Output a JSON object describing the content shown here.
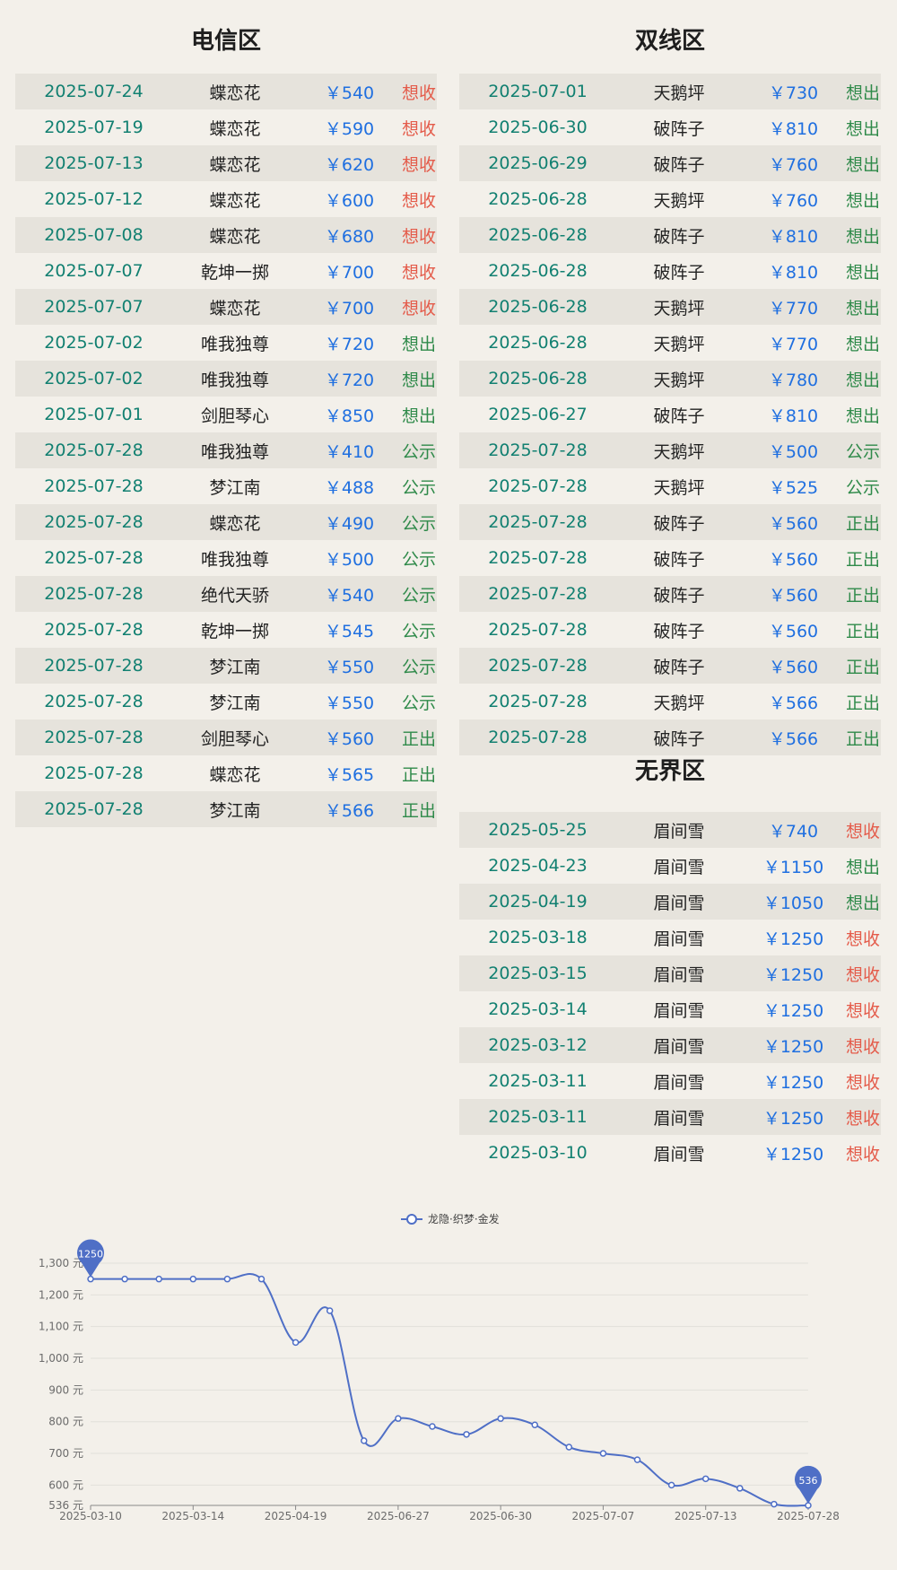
{
  "sections": {
    "telecom": {
      "title": "电信区",
      "rows": [
        {
          "date": "2025-07-24",
          "name": "蝶恋花",
          "price": "￥540",
          "status": "想收"
        },
        {
          "date": "2025-07-19",
          "name": "蝶恋花",
          "price": "￥590",
          "status": "想收"
        },
        {
          "date": "2025-07-13",
          "name": "蝶恋花",
          "price": "￥620",
          "status": "想收"
        },
        {
          "date": "2025-07-12",
          "name": "蝶恋花",
          "price": "￥600",
          "status": "想收"
        },
        {
          "date": "2025-07-08",
          "name": "蝶恋花",
          "price": "￥680",
          "status": "想收"
        },
        {
          "date": "2025-07-07",
          "name": "乾坤一掷",
          "price": "￥700",
          "status": "想收"
        },
        {
          "date": "2025-07-07",
          "name": "蝶恋花",
          "price": "￥700",
          "status": "想收"
        },
        {
          "date": "2025-07-02",
          "name": "唯我独尊",
          "price": "￥720",
          "status": "想出"
        },
        {
          "date": "2025-07-02",
          "name": "唯我独尊",
          "price": "￥720",
          "status": "想出"
        },
        {
          "date": "2025-07-01",
          "name": "剑胆琴心",
          "price": "￥850",
          "status": "想出"
        },
        {
          "date": "2025-07-28",
          "name": "唯我独尊",
          "price": "￥410",
          "status": "公示"
        },
        {
          "date": "2025-07-28",
          "name": "梦江南",
          "price": "￥488",
          "status": "公示"
        },
        {
          "date": "2025-07-28",
          "name": "蝶恋花",
          "price": "￥490",
          "status": "公示"
        },
        {
          "date": "2025-07-28",
          "name": "唯我独尊",
          "price": "￥500",
          "status": "公示"
        },
        {
          "date": "2025-07-28",
          "name": "绝代天骄",
          "price": "￥540",
          "status": "公示"
        },
        {
          "date": "2025-07-28",
          "name": "乾坤一掷",
          "price": "￥545",
          "status": "公示"
        },
        {
          "date": "2025-07-28",
          "name": "梦江南",
          "price": "￥550",
          "status": "公示"
        },
        {
          "date": "2025-07-28",
          "name": "梦江南",
          "price": "￥550",
          "status": "公示"
        },
        {
          "date": "2025-07-28",
          "name": "剑胆琴心",
          "price": "￥560",
          "status": "正出"
        },
        {
          "date": "2025-07-28",
          "name": "蝶恋花",
          "price": "￥565",
          "status": "正出"
        },
        {
          "date": "2025-07-28",
          "name": "梦江南",
          "price": "￥566",
          "status": "正出"
        }
      ]
    },
    "dual": {
      "title": "双线区",
      "rows": [
        {
          "date": "2025-07-01",
          "name": "天鹅坪",
          "price": "￥730",
          "status": "想出"
        },
        {
          "date": "2025-06-30",
          "name": "破阵子",
          "price": "￥810",
          "status": "想出"
        },
        {
          "date": "2025-06-29",
          "name": "破阵子",
          "price": "￥760",
          "status": "想出"
        },
        {
          "date": "2025-06-28",
          "name": "天鹅坪",
          "price": "￥760",
          "status": "想出"
        },
        {
          "date": "2025-06-28",
          "name": "破阵子",
          "price": "￥810",
          "status": "想出"
        },
        {
          "date": "2025-06-28",
          "name": "破阵子",
          "price": "￥810",
          "status": "想出"
        },
        {
          "date": "2025-06-28",
          "name": "天鹅坪",
          "price": "￥770",
          "status": "想出"
        },
        {
          "date": "2025-06-28",
          "name": "天鹅坪",
          "price": "￥770",
          "status": "想出"
        },
        {
          "date": "2025-06-28",
          "name": "天鹅坪",
          "price": "￥780",
          "status": "想出"
        },
        {
          "date": "2025-06-27",
          "name": "破阵子",
          "price": "￥810",
          "status": "想出"
        },
        {
          "date": "2025-07-28",
          "name": "天鹅坪",
          "price": "￥500",
          "status": "公示"
        },
        {
          "date": "2025-07-28",
          "name": "天鹅坪",
          "price": "￥525",
          "status": "公示"
        },
        {
          "date": "2025-07-28",
          "name": "破阵子",
          "price": "￥560",
          "status": "正出"
        },
        {
          "date": "2025-07-28",
          "name": "破阵子",
          "price": "￥560",
          "status": "正出"
        },
        {
          "date": "2025-07-28",
          "name": "破阵子",
          "price": "￥560",
          "status": "正出"
        },
        {
          "date": "2025-07-28",
          "name": "破阵子",
          "price": "￥560",
          "status": "正出"
        },
        {
          "date": "2025-07-28",
          "name": "破阵子",
          "price": "￥560",
          "status": "正出"
        },
        {
          "date": "2025-07-28",
          "name": "天鹅坪",
          "price": "￥566",
          "status": "正出"
        },
        {
          "date": "2025-07-28",
          "name": "破阵子",
          "price": "￥566",
          "status": "正出"
        }
      ]
    },
    "boundless": {
      "title": "无界区",
      "rows": [
        {
          "date": "2025-05-25",
          "name": "眉间雪",
          "price": "￥740",
          "status": "想收"
        },
        {
          "date": "2025-04-23",
          "name": "眉间雪",
          "price": "￥1150",
          "status": "想出"
        },
        {
          "date": "2025-04-19",
          "name": "眉间雪",
          "price": "￥1050",
          "status": "想出"
        },
        {
          "date": "2025-03-18",
          "name": "眉间雪",
          "price": "￥1250",
          "status": "想收"
        },
        {
          "date": "2025-03-15",
          "name": "眉间雪",
          "price": "￥1250",
          "status": "想收"
        },
        {
          "date": "2025-03-14",
          "name": "眉间雪",
          "price": "￥1250",
          "status": "想收"
        },
        {
          "date": "2025-03-12",
          "name": "眉间雪",
          "price": "￥1250",
          "status": "想收"
        },
        {
          "date": "2025-03-11",
          "name": "眉间雪",
          "price": "￥1250",
          "status": "想收"
        },
        {
          "date": "2025-03-11",
          "name": "眉间雪",
          "price": "￥1250",
          "status": "想收"
        },
        {
          "date": "2025-03-10",
          "name": "眉间雪",
          "price": "￥1250",
          "status": "想收"
        }
      ]
    }
  },
  "status_colors": {
    "想收": "#e45b4a",
    "想出": "#2f8a4a",
    "公示": "#2f8a4a",
    "正出": "#2f8a4a"
  },
  "chart_data": {
    "type": "line",
    "legend": {
      "position": "top-center",
      "entries": [
        "龙隐·织梦·金发"
      ]
    },
    "series": [
      {
        "name": "龙隐·织梦·金发",
        "color": "#4f6fc6",
        "values": [
          1250,
          1250,
          1250,
          1250,
          1250,
          1250,
          1050,
          1150,
          740,
          810,
          785,
          760,
          810,
          790,
          720,
          700,
          680,
          600,
          620,
          590,
          540,
          536
        ]
      }
    ],
    "x_tick_labels": [
      "2025-03-10",
      "2025-03-14",
      "2025-04-19",
      "2025-06-27",
      "2025-06-30",
      "2025-07-07",
      "2025-07-13",
      "2025-07-28"
    ],
    "y_tick_labels": [
      "536 元",
      "600 元",
      "700 元",
      "800 元",
      "900 元",
      "1,000 元",
      "1,100 元",
      "1,200 元",
      "1,300 元"
    ],
    "ylim": [
      536,
      1300
    ],
    "grid": true,
    "markers": {
      "max": "1250",
      "min": "536"
    }
  }
}
